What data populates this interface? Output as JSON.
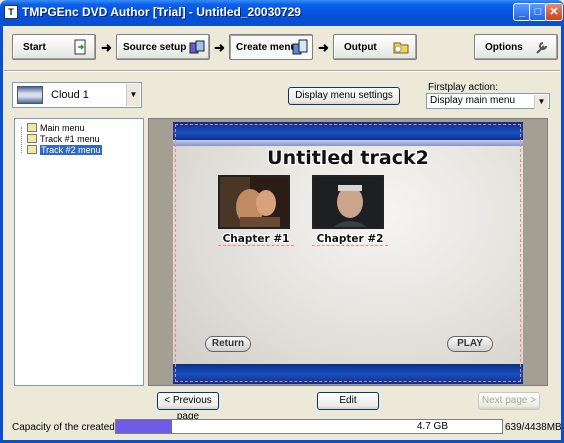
{
  "window": {
    "title": "TMPGEnc DVD Author [Trial] - Untitled_20030729"
  },
  "steps": [
    {
      "label": "Start",
      "icon": "document-arrow-icon"
    },
    {
      "label": "Source setup",
      "icon": "stacked-boxes-icon"
    },
    {
      "label": "Create menu",
      "icon": "menu-stack-icon",
      "active": true
    },
    {
      "label": "Output",
      "icon": "disc-folder-icon"
    }
  ],
  "options_label": "Options",
  "menu_template": {
    "value": "Cloud 1"
  },
  "display_menu_settings_label": "Display menu settings",
  "firstplay": {
    "label": "Firstplay action:",
    "value": "Display main menu"
  },
  "tree": [
    {
      "label": "Main menu",
      "selected": false
    },
    {
      "label": "Track #1 menu",
      "selected": false
    },
    {
      "label": "Track #2 menu",
      "selected": true
    }
  ],
  "preview": {
    "title": "Untitled track2",
    "chapters": [
      {
        "label": "Chapter #1"
      },
      {
        "label": "Chapter #2"
      }
    ],
    "return_label": "Return",
    "play_label": "PLAY"
  },
  "nav": {
    "previous_label": "< Previous page",
    "edit_label": "Edit",
    "next_label": "Next page >"
  },
  "status": {
    "capacity_label": "Capacity of the created DVD:",
    "capacity_text": "4.7 GB",
    "used_text": "639/4438MB",
    "used_fraction": 0.144,
    "fill_color": "#6f5be6"
  }
}
